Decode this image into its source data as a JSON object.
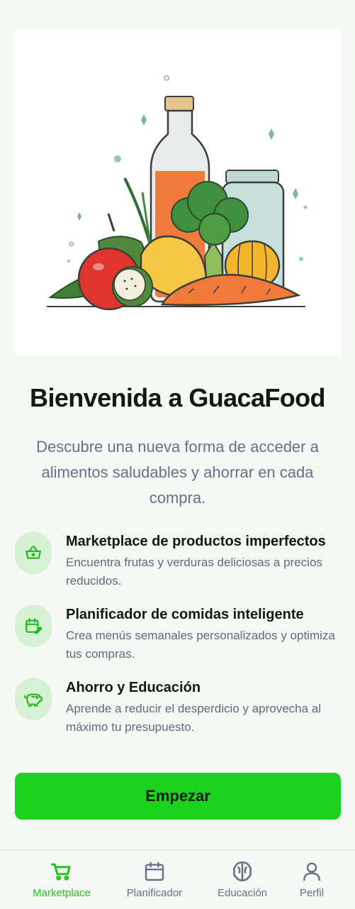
{
  "hero": {
    "image": "vegetables-and-jars-illustration"
  },
  "welcome": {
    "title": "Bienvenida a GuacaFood",
    "subtitle": "Descubre una nueva forma de acceder a alimentos saludables y ahorrar en cada compra."
  },
  "features": [
    {
      "icon": "basket-icon",
      "title": "Marketplace de productos imperfectos",
      "description": "Encuentra frutas y verduras deliciosas a precios reducidos."
    },
    {
      "icon": "calendar-edit-icon",
      "title": "Planificador de comidas inteligente",
      "description": "Crea menús semanales personalizados y optimiza tus compras."
    },
    {
      "icon": "piggy-bank-icon",
      "title": "Ahorro y Educación",
      "description": "Aprende a reducir el desperdicio y aprovecha al máximo tu presupuesto."
    }
  ],
  "cta": {
    "label": "Empezar"
  },
  "tabbar": {
    "active": "Marketplace",
    "items": [
      {
        "label": "Marketplace",
        "icon": "cart-icon"
      },
      {
        "label": "Planificador",
        "icon": "calendar-icon"
      },
      {
        "label": "Educación",
        "icon": "brain-icon"
      },
      {
        "label": "Perfil",
        "icon": "user-icon"
      }
    ]
  },
  "colors": {
    "accent": "#1dd21d",
    "active_tab": "#22c31f",
    "icon_bg": "#d6f1d4",
    "background": "#f5f8f4"
  }
}
